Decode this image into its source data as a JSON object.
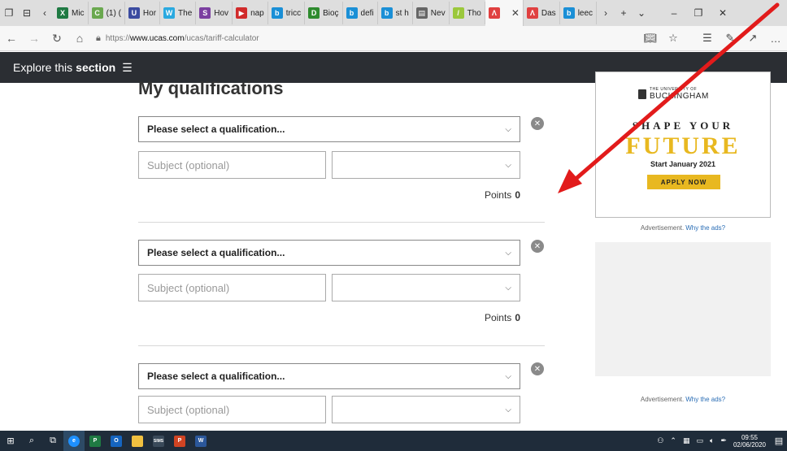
{
  "browser": {
    "tabs": [
      {
        "label": "Mic",
        "color": "#1f7a43",
        "glyph": "X"
      },
      {
        "label": "(1) (",
        "color": "#6aa84f",
        "glyph": "C"
      },
      {
        "label": "Hor",
        "color": "#3b4ba0",
        "glyph": "U"
      },
      {
        "label": "The",
        "color": "#2aa9e0",
        "glyph": "W"
      },
      {
        "label": "Hov",
        "color": "#7b3fa0",
        "glyph": "S"
      },
      {
        "label": "nap",
        "color": "#d12b2b",
        "glyph": "▶"
      },
      {
        "label": "tricc",
        "color": "#1a8fd6",
        "glyph": "b"
      },
      {
        "label": "Bioç",
        "color": "#2e8b2e",
        "glyph": "D"
      },
      {
        "label": "defi",
        "color": "#1a8fd6",
        "glyph": "b"
      },
      {
        "label": "st h",
        "color": "#1a8fd6",
        "glyph": "b"
      },
      {
        "label": "Nev",
        "color": "#666666",
        "glyph": "▤"
      },
      {
        "label": "Tho",
        "color": "#9bc83c",
        "glyph": "/"
      },
      {
        "label": "",
        "color": "#e04040",
        "glyph": "Λ",
        "active": true
      },
      {
        "label": "Das",
        "color": "#e04040",
        "glyph": "Λ"
      },
      {
        "label": "leec",
        "color": "#1a8fd6",
        "glyph": "b"
      }
    ],
    "url_prefix": "https://",
    "url_host": "www.ucas.com",
    "url_path": "/ucas/tariff-calculator"
  },
  "section_bar": {
    "label_regular": "Explore this",
    "label_bold": "section"
  },
  "main": {
    "title": "My qualifications",
    "rows": [
      {
        "qual_placeholder": "Please select a qualification...",
        "subject_placeholder": "Subject (optional)",
        "points_label": "Points",
        "points_value": "0"
      },
      {
        "qual_placeholder": "Please select a qualification...",
        "subject_placeholder": "Subject (optional)",
        "points_label": "Points",
        "points_value": "0"
      },
      {
        "qual_placeholder": "Please select a qualification...",
        "subject_placeholder": "Subject (optional)"
      }
    ]
  },
  "ads": {
    "logo_small": "THE UNIVERSITY OF",
    "logo_main": "BUCKINGHAM",
    "headline": "SHAPE YOUR",
    "headline2": "FUTURE",
    "subline": "Start January 2021",
    "cta": "APPLY NOW",
    "note": "Advertisement.",
    "note_link": "Why the ads?",
    "accent": "#e8b820"
  },
  "taskbar": {
    "time": "09:55",
    "date": "02/06/2020"
  },
  "colors": {
    "section_bar": "#2b2e33",
    "arrow": "#e21b1b"
  }
}
